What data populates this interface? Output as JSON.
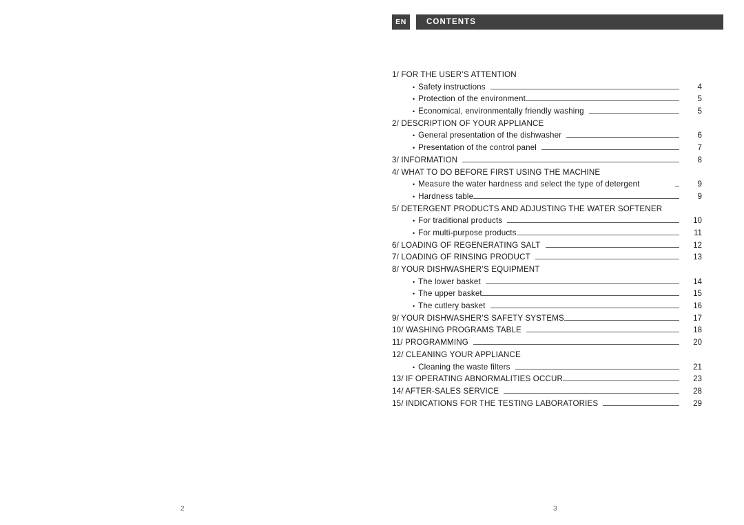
{
  "header": {
    "language_badge": "EN",
    "title": "CONTENTS",
    "bar_color": "#414141",
    "text_color": "#ffffff"
  },
  "toc": {
    "rows": [
      {
        "type": "section",
        "label": "1/ FOR THE USER’S ATTENTION",
        "page": "",
        "leader": "none"
      },
      {
        "type": "sub",
        "bullet": "•",
        "label": "Safety instructions",
        "page": "4",
        "leader": "gap-sm"
      },
      {
        "type": "sub",
        "bullet": "•",
        "label": "Protection of the environment",
        "page": "5",
        "leader": "gap-none"
      },
      {
        "type": "sub",
        "bullet": "•",
        "label": "Economical, environmentally friendly washing",
        "page": "5",
        "leader": "gap-sm"
      },
      {
        "type": "section",
        "label": "2/ DESCRIPTION OF YOUR APPLIANCE",
        "page": "",
        "leader": "none"
      },
      {
        "type": "sub",
        "bullet": "•",
        "label": "General presentation of the dishwasher",
        "page": "6",
        "leader": "gap-sm"
      },
      {
        "type": "sub",
        "bullet": "•",
        "label": "Presentation of the control panel",
        "page": "7",
        "leader": "gap-sm"
      },
      {
        "type": "section",
        "label": "3/ INFORMATION",
        "page": "8",
        "leader": "gap-sm"
      },
      {
        "type": "section",
        "label": "4/ WHAT TO DO BEFORE FIRST USING THE MACHINE",
        "page": "",
        "leader": "none"
      },
      {
        "type": "sub",
        "bullet": "•",
        "label": "Measure the water hardness and select the type of detergent",
        "page": "9",
        "leader": "tiny"
      },
      {
        "type": "sub",
        "bullet": "•",
        "label": "Hardness table",
        "page": "9",
        "leader": "gap-none"
      },
      {
        "type": "section",
        "label": "5/ DETERGENT PRODUCTS AND ADJUSTING THE WATER SOFTENER",
        "page": "",
        "leader": "none"
      },
      {
        "type": "sub",
        "bullet": "•",
        "label": "For traditional products",
        "page": "10",
        "leader": "gap-sm"
      },
      {
        "type": "sub",
        "bullet": "•",
        "label": "For multi-purpose products",
        "page": "11",
        "leader": "gap-none"
      },
      {
        "type": "section",
        "label": "6/ LOADING OF REGENERATING SALT",
        "page": "12",
        "leader": "gap-sm"
      },
      {
        "type": "section",
        "label": "7/ LOADING OF RINSING PRODUCT",
        "page": "13",
        "leader": "gap-sm"
      },
      {
        "type": "section",
        "label": "8/ YOUR DISHWASHER’S EQUIPMENT",
        "page": "",
        "leader": "none"
      },
      {
        "type": "sub",
        "bullet": "•",
        "label": "The lower basket",
        "page": "14",
        "leader": "gap-sm"
      },
      {
        "type": "sub",
        "bullet": "•",
        "label": "The upper basket",
        "page": "15",
        "leader": "gap-none"
      },
      {
        "type": "sub",
        "bullet": "•",
        "label": "The cutlery basket",
        "page": "16",
        "leader": "gap-sm"
      },
      {
        "type": "section",
        "label": "9/ YOUR DISHWASHER’S SAFETY SYSTEMS",
        "page": "17",
        "leader": "gap-none"
      },
      {
        "type": "section",
        "label": "10/ WASHING PROGRAMS TABLE",
        "page": "18",
        "leader": "gap-sm"
      },
      {
        "type": "section",
        "label": "11/ PROGRAMMING",
        "page": "20",
        "leader": "gap-sm"
      },
      {
        "type": "section",
        "label": "12/ CLEANING YOUR APPLIANCE",
        "page": "",
        "leader": "none"
      },
      {
        "type": "sub",
        "bullet": "•",
        "label": "Cleaning the waste filters",
        "page": "21",
        "leader": "gap-sm"
      },
      {
        "type": "section",
        "label": "13/ IF OPERATING ABNORMALITIES OCCUR",
        "page": "23",
        "leader": "gap-none"
      },
      {
        "type": "section",
        "label": "14/ AFTER-SALES SERVICE",
        "page": "28",
        "leader": "gap-sm"
      },
      {
        "type": "section",
        "label": "15/ INDICATIONS FOR THE TESTING LABORATORIES",
        "page": "29",
        "leader": "gap-sm"
      }
    ]
  },
  "footer": {
    "left_page": "2",
    "center_page": "3"
  }
}
